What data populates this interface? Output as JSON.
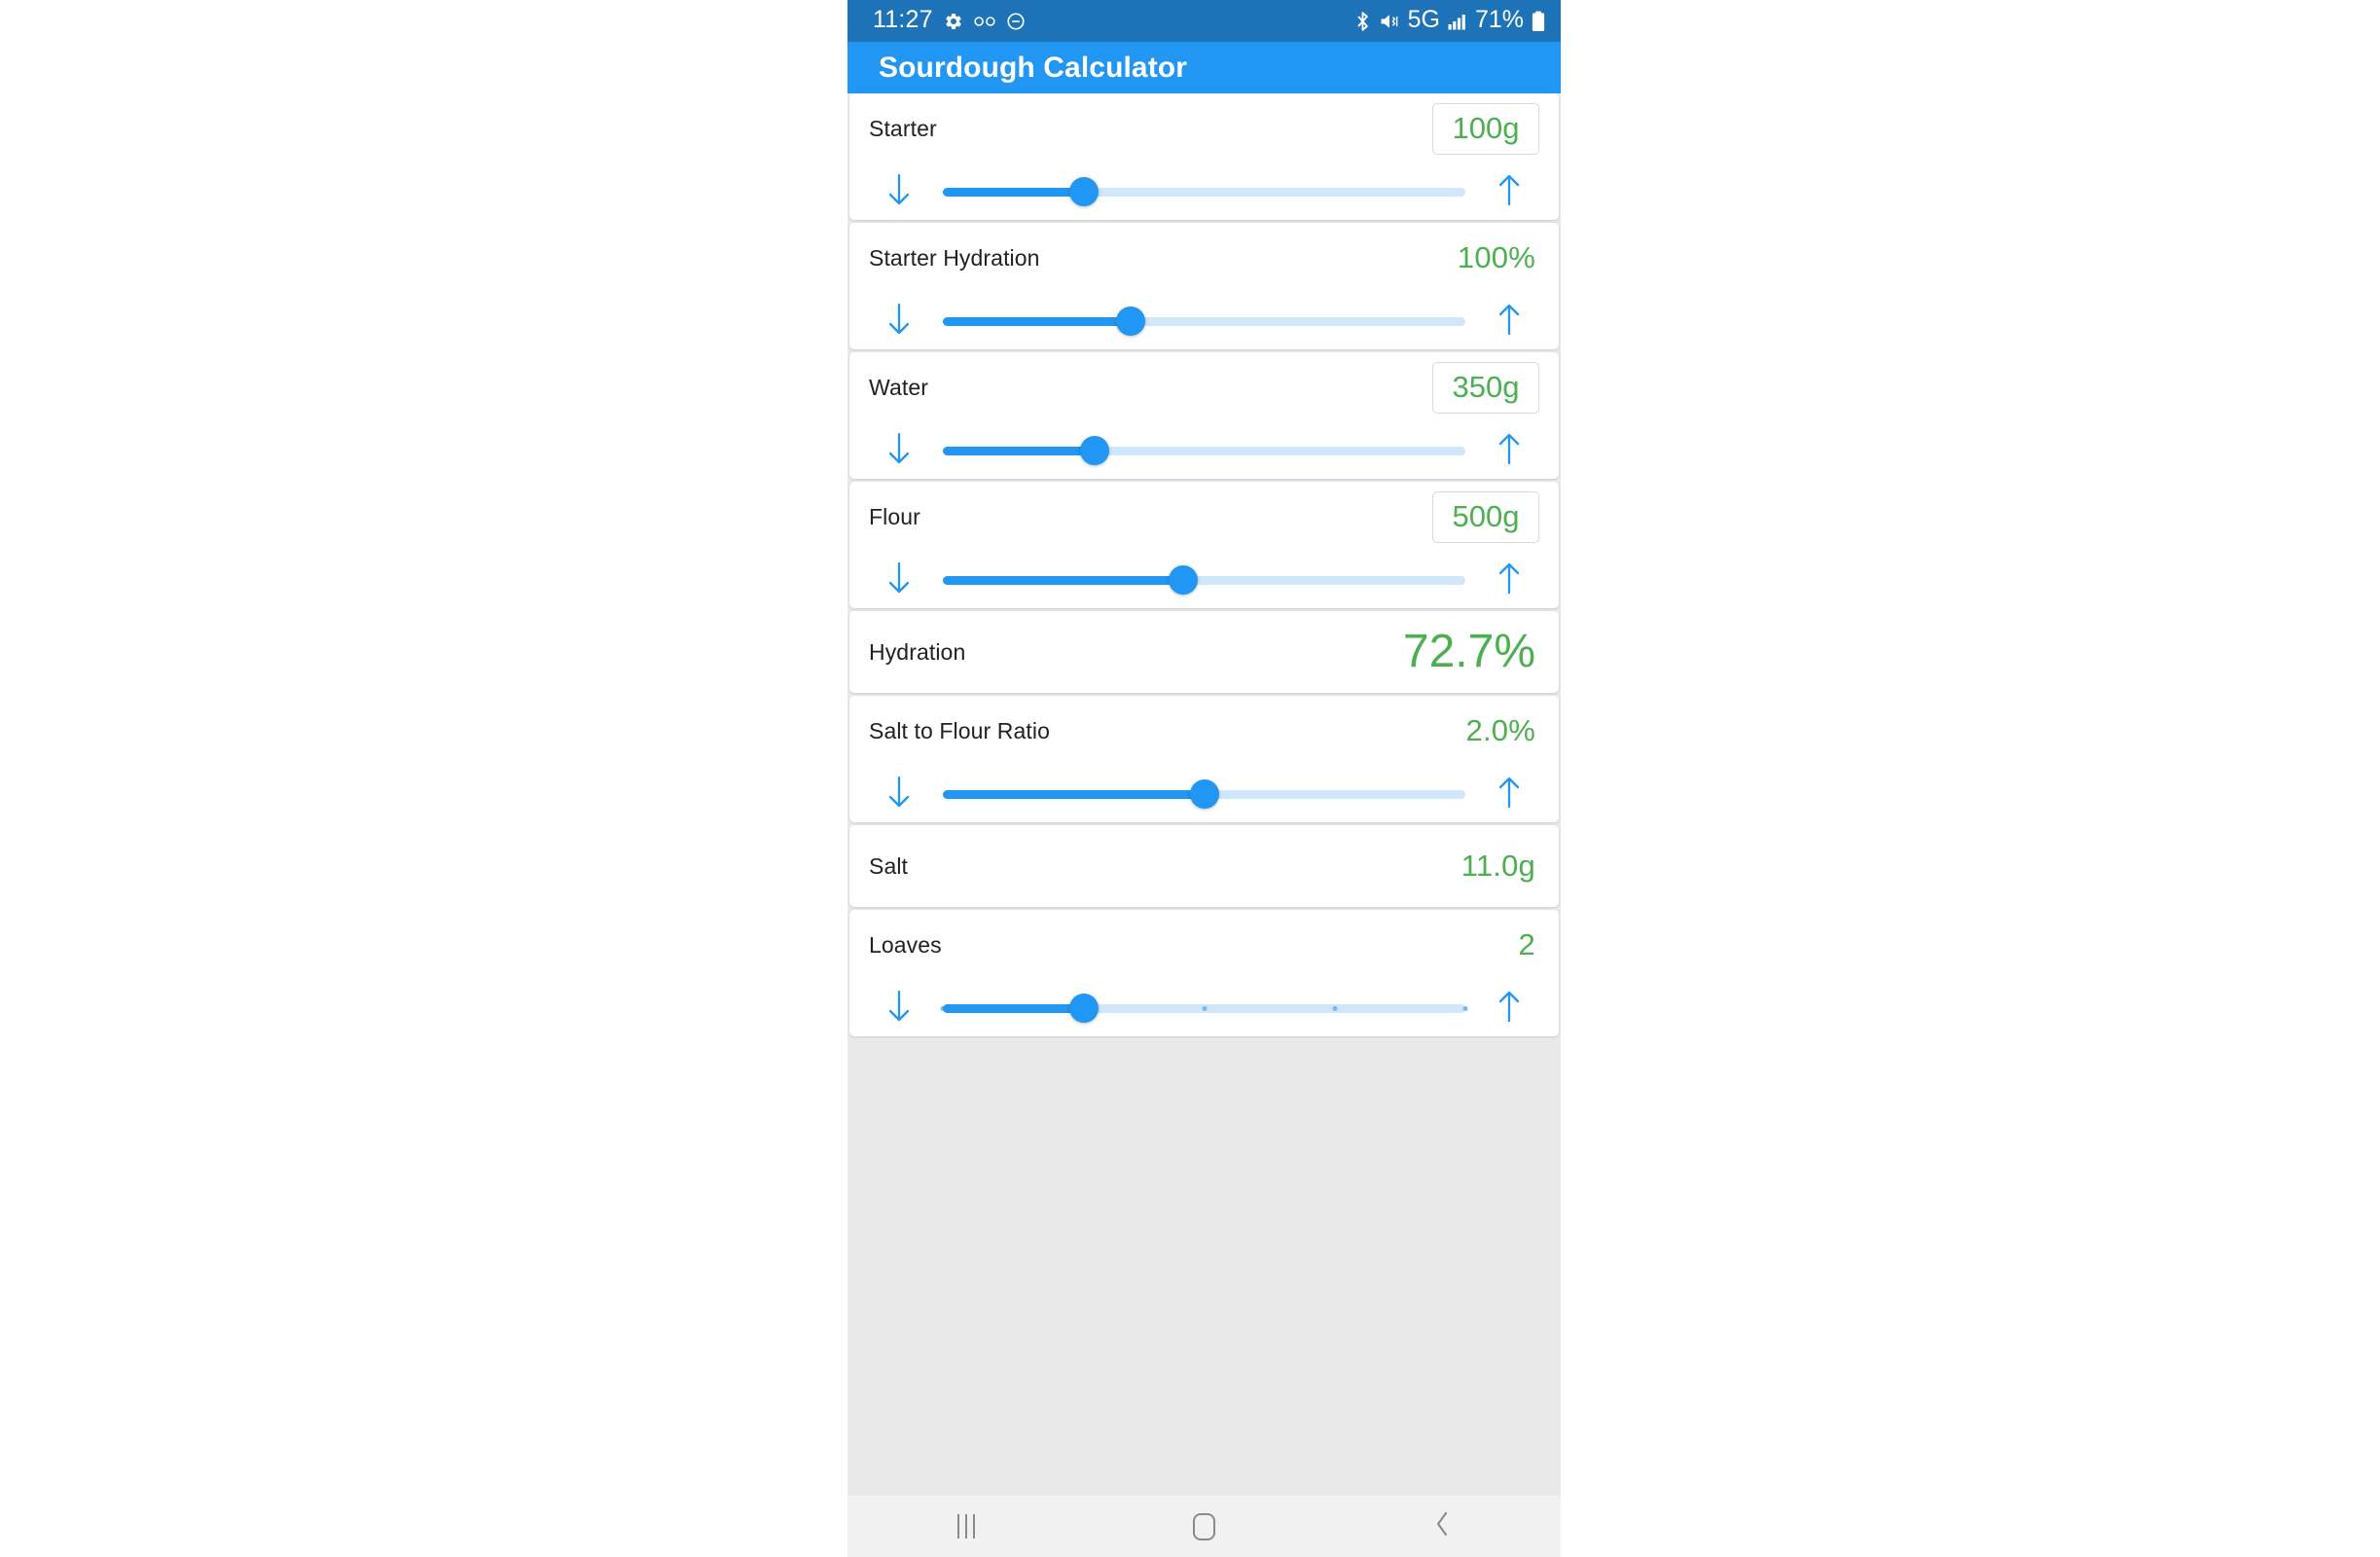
{
  "status_bar": {
    "time": "11:27",
    "left_icons": [
      "gear-icon",
      "voicemail-icon",
      "minus-circle-icon"
    ],
    "right_icons": [
      "bluetooth-icon",
      "mute-vibrate-icon",
      "network-5g-icon",
      "signal-bars-icon"
    ],
    "network_label": "5G",
    "battery_percent": "71%",
    "background_color": "#1d72b8"
  },
  "app_bar": {
    "title": "Sourdough Calculator",
    "background_color": "#2196f3",
    "text_color": "#ffffff"
  },
  "theme": {
    "accent_blue": "#2196f3",
    "track_inactive": "#cfe6fb",
    "value_green": "#4caf50",
    "page_background": "#e9e9e9",
    "card_background": "#ffffff"
  },
  "cards": [
    {
      "name": "starter",
      "label": "Starter",
      "value": "100g",
      "value_style": "boxed",
      "has_slider": true,
      "slider_percent": 27,
      "ticks": 0,
      "decrement_icon": "arrow-down-icon",
      "increment_icon": "arrow-up-icon"
    },
    {
      "name": "starter-hydration",
      "label": "Starter Hydration",
      "value": "100%",
      "value_style": "plain",
      "has_slider": true,
      "slider_percent": 36,
      "ticks": 0,
      "decrement_icon": "arrow-down-icon",
      "increment_icon": "arrow-up-icon"
    },
    {
      "name": "water",
      "label": "Water",
      "value": "350g",
      "value_style": "boxed",
      "has_slider": true,
      "slider_percent": 29,
      "ticks": 0,
      "decrement_icon": "arrow-down-icon",
      "increment_icon": "arrow-up-icon"
    },
    {
      "name": "flour",
      "label": "Flour",
      "value": "500g",
      "value_style": "boxed",
      "has_slider": true,
      "slider_percent": 46,
      "ticks": 0,
      "decrement_icon": "arrow-down-icon",
      "increment_icon": "arrow-up-icon"
    },
    {
      "name": "hydration",
      "label": "Hydration",
      "value": "72.7%",
      "value_style": "plain-big",
      "has_slider": false
    },
    {
      "name": "salt-to-flour-ratio",
      "label": "Salt to Flour Ratio",
      "value": "2.0%",
      "value_style": "plain",
      "has_slider": true,
      "slider_percent": 50,
      "ticks": 0,
      "decrement_icon": "arrow-down-icon",
      "increment_icon": "arrow-up-icon"
    },
    {
      "name": "salt",
      "label": "Salt",
      "value": "11.0g",
      "value_style": "plain",
      "has_slider": false
    },
    {
      "name": "loaves",
      "label": "Loaves",
      "value": "2",
      "value_style": "plain",
      "has_slider": true,
      "slider_percent": 27,
      "ticks": 5,
      "decrement_icon": "arrow-down-icon",
      "increment_icon": "arrow-up-icon"
    }
  ],
  "nav_bar": {
    "recents_label": "recents-icon",
    "home_label": "home-icon",
    "back_label": "back-icon",
    "background_color": "#f1f1f1"
  }
}
